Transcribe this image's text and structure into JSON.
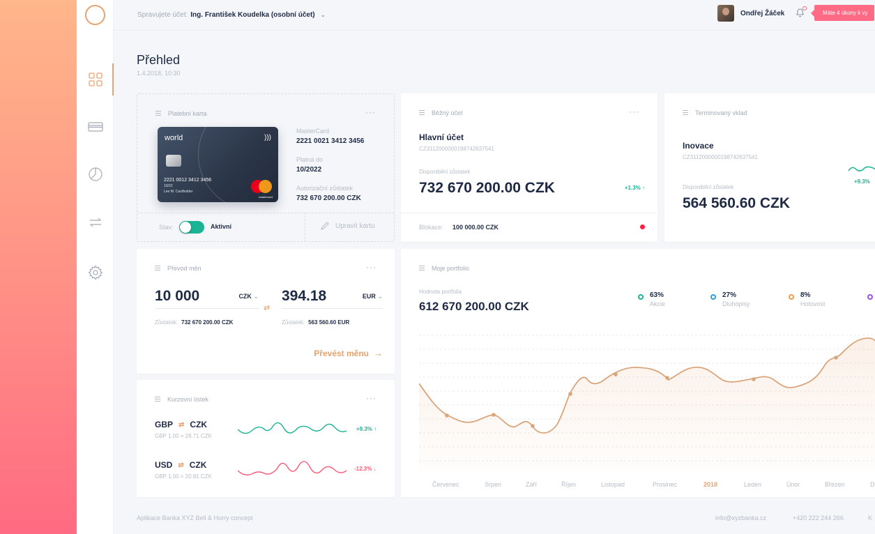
{
  "topbar": {
    "managing_label": "Spravujete účet:",
    "account_name": "Ing. František Koudelka (osobní účet)",
    "user_name": "Ondřej Žáček",
    "notification": "Máte 4 úkony k vy"
  },
  "page": {
    "title": "Přehled",
    "date": "1.4.2018, 10:30"
  },
  "payment_card": {
    "title": "Platební karta",
    "brand_label": "world",
    "card_number_on_card": "2221 0012 3412 3456",
    "expiry_on_card": "10/22",
    "holder_on_card": "Lee M. Cardholder",
    "mastercard_text": "mastercard",
    "type_label": "MasterCard",
    "number": "2221 0021 3412 3456",
    "valid_label": "Platná do",
    "valid": "10/2022",
    "auth_label": "Autorizační zůstatek",
    "auth_balance": "732 670 200.00 CZK",
    "status_label": "Stav:",
    "status_value": "Aktivní",
    "edit_label": "Upravit kartu"
  },
  "current_account": {
    "title": "Běžný účet",
    "name": "Hlavní účet",
    "iban": "CZ3112000000198742637541",
    "available_label": "Disponibilní zůstatek",
    "balance": "732 670 200.00 CZK",
    "change": "+1.3%",
    "block_label": "Blokace:",
    "block_value": "100 000.00 CZK"
  },
  "term_deposit": {
    "title": "Terminovaný vklad",
    "name": "Inovace",
    "iban": "CZ3112000000198742637541",
    "available_label": "Disponibilní zůstatek",
    "balance": "564 560.60 CZK",
    "change": "+9.3%"
  },
  "exchange": {
    "title": "Převod měn",
    "from_amount": "10 000",
    "from_currency": "CZK",
    "to_amount": "394.18",
    "to_currency": "EUR",
    "from_balance_label": "Zůstatek:",
    "from_balance": "732 670 200.00 CZK",
    "to_balance_label": "Zůstatek:",
    "to_balance": "563 560.60 EUR",
    "action": "Převést měnu"
  },
  "rates": {
    "title": "Kurzovní lístek",
    "items": [
      {
        "from": "GBP",
        "to": "CZK",
        "rate": "GBP 1.00 = 28.71 CZK",
        "change": "+9.3%",
        "trend": "up"
      },
      {
        "from": "USD",
        "to": "CZK",
        "rate": "GBP 1.00 = 20.81 CZK",
        "change": "-12.3%",
        "trend": "down"
      }
    ]
  },
  "portfolio": {
    "title": "Moje portfolio",
    "value_label": "Hodnota portfolia",
    "value": "612 670 200.00 CZK",
    "legend": [
      {
        "pct": "63%",
        "name": "Akcie",
        "color": "#1bb394"
      },
      {
        "pct": "27%",
        "name": "Dluhopisy",
        "color": "#2d9cdb"
      },
      {
        "pct": "8%",
        "name": "Hotovost",
        "color": "#f2994a"
      },
      {
        "pct": "",
        "name": "",
        "color": "#9b51e0"
      }
    ],
    "months": [
      "Červenec",
      "Srpen",
      "Září",
      "Říjen",
      "Listopad",
      "Prosinec",
      "2018",
      "Leden",
      "Únor",
      "Březen",
      "D"
    ]
  },
  "footer": {
    "left": "Aplikace Banka XYZ Bell & Hurry concept",
    "email": "info@xyzbanka.cz",
    "phone": "+420 222 244 266",
    "cut": "K"
  },
  "colors": {
    "accent": "#e8a26e",
    "positive": "#1bb394",
    "negative": "#ff5a76",
    "dark": "#1e2a44"
  }
}
